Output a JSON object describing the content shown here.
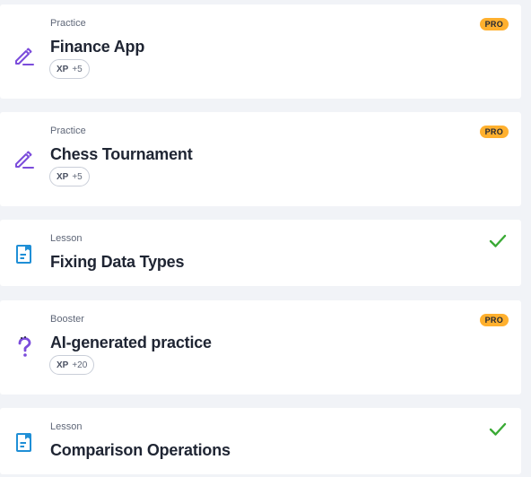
{
  "items": [
    {
      "type": "Practice",
      "title": "Finance App",
      "xp_label": "XP",
      "xp_value": "+5",
      "badge": "PRO",
      "icon": "pencil-icon",
      "status": "pro"
    },
    {
      "type": "Practice",
      "title": "Chess Tournament",
      "xp_label": "XP",
      "xp_value": "+5",
      "badge": "PRO",
      "icon": "pencil-icon",
      "status": "pro"
    },
    {
      "type": "Lesson",
      "title": "Fixing Data Types",
      "icon": "lesson-icon",
      "status": "completed"
    },
    {
      "type": "Booster",
      "title": "AI-generated practice",
      "xp_label": "XP",
      "xp_value": "+20",
      "badge": "PRO",
      "icon": "question-icon",
      "status": "pro"
    },
    {
      "type": "Lesson",
      "title": "Comparison Operations",
      "icon": "lesson-icon",
      "status": "completed"
    }
  ],
  "colors": {
    "background": "#f1f3f7",
    "card": "#ffffff",
    "pro_badge": "#ffb02e",
    "practice_icon": "#7b4cdb",
    "lesson_icon": "#1f8fd6",
    "check": "#3aaa35"
  }
}
